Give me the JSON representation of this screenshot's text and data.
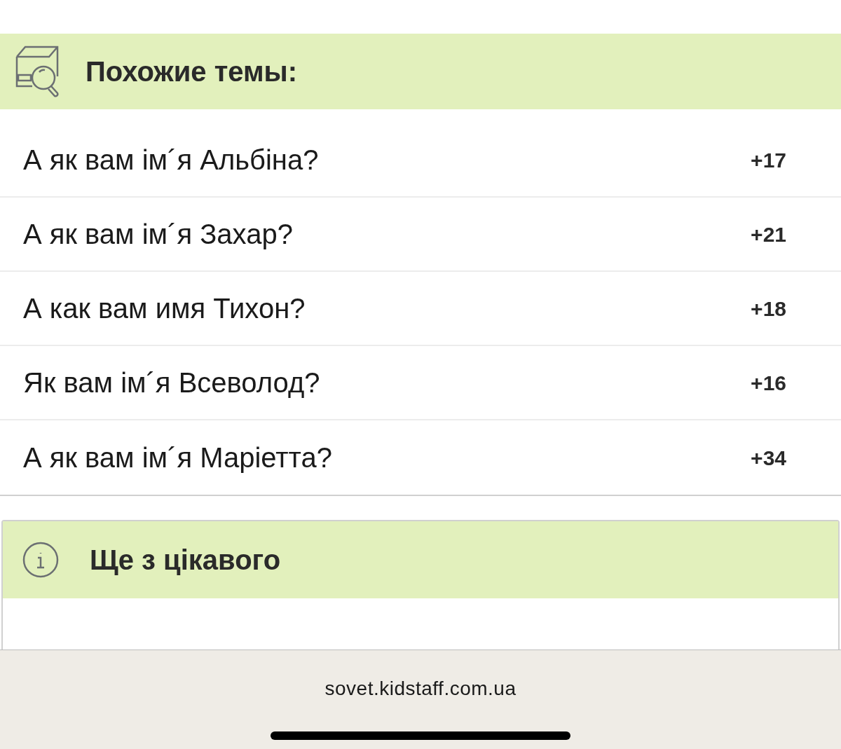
{
  "similar_topics": {
    "title": "Похожие темы:",
    "items": [
      {
        "title": "А як вам ім´я Альбіна?",
        "count": "+17"
      },
      {
        "title": "А як вам ім´я Захар?",
        "count": "+21"
      },
      {
        "title": "А как вам имя Тихон?",
        "count": "+18"
      },
      {
        "title": "Як вам ім´я Всеволод?",
        "count": "+16"
      },
      {
        "title": "А як вам ім´я Маріетта?",
        "count": "+34"
      }
    ]
  },
  "more_interesting": {
    "title": "Ще з цікавого"
  },
  "browser_bar": {
    "url": "sovet.kidstaff.com.ua"
  }
}
